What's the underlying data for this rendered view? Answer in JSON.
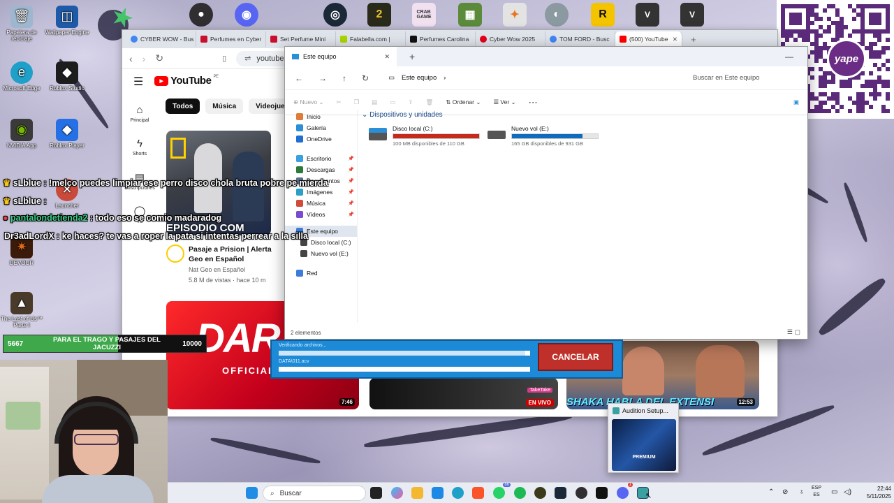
{
  "desktop": {
    "icons": [
      {
        "label": "Papelera de reciclaje",
        "icon": "recycle-bin-icon"
      },
      {
        "label": "Wallpaper Engine",
        "icon": "wallpaper-engine-icon"
      },
      {
        "label": "Microsoft Edge",
        "icon": "edge-icon"
      },
      {
        "label": "Roblox Studio",
        "icon": "roblox-studio-icon"
      },
      {
        "label": "NVIDIA App",
        "icon": "nvidia-icon"
      },
      {
        "label": "Roblox Player",
        "icon": "roblox-player-icon"
      },
      {
        "label": "DEVOUR",
        "icon": "devour-icon"
      },
      {
        "label": "The Last of Us™ Parte I",
        "icon": "tlou-icon"
      }
    ],
    "launcher_label": "Launcher"
  },
  "browser": {
    "tabs": [
      {
        "label": "CYBER WOW - Bus",
        "color": "#4285f4"
      },
      {
        "label": "Perfumes en Cyber",
        "color": "#c8102e"
      },
      {
        "label": "Set Perfume Mini",
        "color": "#c8102e"
      },
      {
        "label": "Falabella.com |",
        "color": "#aad500"
      },
      {
        "label": "Perfumes Carolina",
        "color": "#111111"
      },
      {
        "label": "Cyber Wow 2025",
        "color": "#e3001b"
      },
      {
        "label": "TOM FORD - Busc",
        "color": "#4285f4"
      },
      {
        "label": "(500) YouTube",
        "color": "#ff0000"
      }
    ],
    "url": "youtube."
  },
  "youtube": {
    "logo": "YouTube",
    "region": "PE",
    "sidebar": [
      {
        "label": "Principal",
        "icon": "home-icon"
      },
      {
        "label": "Shorts",
        "icon": "shorts-icon"
      },
      {
        "label": "Suscripciones",
        "icon": "subscriptions-icon"
      },
      {
        "label": "Tú",
        "icon": "user-icon"
      }
    ],
    "chips": [
      "Todos",
      "Música",
      "Videojue"
    ],
    "video1": {
      "thumb_text": "EPISODIO COM",
      "title_line1": "Pasaje a Prision | Alerta",
      "title_line2": "Geo en Español",
      "channel": "Nat Geo en Español",
      "stats": "5.8 M de vistas · hace 10 m"
    },
    "video2": {
      "thumb_text": "DAR",
      "thumb_sub": "OFFICIAL",
      "duration": "7:46"
    },
    "video3": {
      "badge": "EN VIVO",
      "badge_top": "TakeTake"
    },
    "video4": {
      "thumb_text": "SHAKA HABLA DEL EXTENSI",
      "duration": "12:53"
    }
  },
  "explorer": {
    "tab_title": "Este equipo",
    "breadcrumb": "Este equipo",
    "search_placeholder": "Buscar en Este equipo",
    "toolbar": {
      "new": "Nuevo",
      "sort": "Ordenar",
      "view": "Ver"
    },
    "nav_items": [
      {
        "label": "Inicio",
        "color": "#e07b39"
      },
      {
        "label": "Galería",
        "color": "#2a8fd6"
      },
      {
        "label": "OneDrive",
        "color": "#1e6fd0"
      },
      {
        "label": "Escritorio",
        "color": "#3aa0e0",
        "pinned": true
      },
      {
        "label": "Descargas",
        "color": "#2c7a3a",
        "pinned": true
      },
      {
        "label": "Documentos",
        "color": "#5a6f8a",
        "pinned": true
      },
      {
        "label": "Imágenes",
        "color": "#2aa0c8",
        "pinned": true
      },
      {
        "label": "Música",
        "color": "#d14a3a",
        "pinned": true
      },
      {
        "label": "Vídeos",
        "color": "#7a4ad0",
        "pinned": true
      },
      {
        "label": "Este equipo",
        "color": "#3b7dd8"
      },
      {
        "label": "Disco local (C:)",
        "color": "#444444"
      },
      {
        "label": "Nuevo vol (E:)",
        "color": "#444444"
      },
      {
        "label": "Red",
        "color": "#3b7dd8"
      }
    ],
    "section_title": "Dispositivos y unidades",
    "drives": [
      {
        "name": "Disco local (C:)",
        "free": "100 MB disponibles de 110 GB",
        "used_fraction": 0.999,
        "color": "#c42b1c"
      },
      {
        "name": "Nuevo vol (E:)",
        "free": "165 GB disponibles de 931 GB",
        "used_fraction": 0.82,
        "color": "#0f6cbd"
      }
    ],
    "status": "2 elementos"
  },
  "installer": {
    "status1": "Verificando archivos...",
    "status2": "DATA\\011.acv",
    "progress1": 0.98,
    "progress2": 1.0,
    "cancel_label": "CANCELAR"
  },
  "chat": [
    {
      "user": "sLblue",
      "color": "#ffffff",
      "message": "!melco puedes limpiar ese perro disco chola bruta pobre pe mierda"
    },
    {
      "user": "sLblue",
      "color": "#ffffff",
      "message": ""
    },
    {
      "user": "pantalondetienda2",
      "color": "#3fd08a",
      "message": "todo eso se comio madaradog"
    },
    {
      "user": "Dr3adLordX",
      "color": "#ffffff",
      "message": "ke haces? te vas a roper la pata si intentas perrear a la silla"
    }
  ],
  "goal": {
    "current": "5667",
    "label": "PARA EL TRAGO Y PASAJES DEL JACUZZI",
    "target": "10000",
    "progress": 0.5667
  },
  "taskbar": {
    "search_placeholder": "Buscar",
    "lang_top": "ESP",
    "lang_bottom": "ES",
    "time": "22:44",
    "date": "5/11/2025",
    "badge1": "86",
    "badge2": "1"
  },
  "popup": {
    "title": "Audition Setup...",
    "preview_text": "PREMIUM"
  },
  "qr_brand": "yape"
}
